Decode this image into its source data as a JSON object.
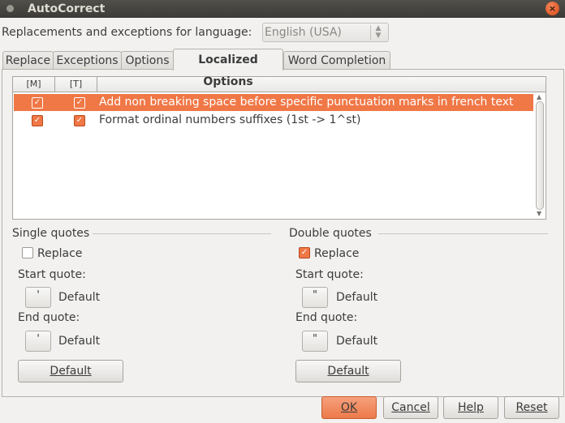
{
  "window": {
    "title": "AutoCorrect",
    "close_glyph": "×"
  },
  "language": {
    "label": "Replacements and exceptions for language:",
    "selected": "English (USA)"
  },
  "tabs": [
    {
      "label": "Replace",
      "active": false
    },
    {
      "label": "Exceptions",
      "active": false
    },
    {
      "label": "Options",
      "active": false
    },
    {
      "label": "Localized Options",
      "active": true
    },
    {
      "label": "Word Completion",
      "active": false
    }
  ],
  "options_list": {
    "columns": [
      "[M]",
      "[T]",
      ""
    ],
    "rows": [
      {
        "m": true,
        "t": true,
        "text": "Add non breaking space before specific punctuation marks in french text",
        "selected": true
      },
      {
        "m": true,
        "t": true,
        "text": "Format ordinal numbers suffixes (1st -> 1^st)",
        "selected": false
      }
    ]
  },
  "single_quotes": {
    "title": "Single quotes",
    "replace_label": "Replace",
    "replace_checked": false,
    "start_label": "Start quote:",
    "start_button": "'",
    "start_value": "Default",
    "end_label": "End quote:",
    "end_button": "'",
    "end_value": "Default",
    "default_button": "Default"
  },
  "double_quotes": {
    "title": "Double quotes",
    "replace_label": "Replace",
    "replace_checked": true,
    "start_label": "Start quote:",
    "start_button": "\"",
    "start_value": "Default",
    "end_label": "End quote:",
    "end_button": "\"",
    "end_value": "Default",
    "default_button": "Default"
  },
  "footer": {
    "ok": "OK",
    "cancel": "Cancel",
    "help": "Help",
    "reset": "Reset"
  },
  "icons": {
    "close": "close-icon",
    "check": "checkmark-icon",
    "spin": "spin-arrows-icon"
  },
  "colors": {
    "accent": "#f07746",
    "titlebar": "#3c3b37",
    "window_bg": "#f2f1f0"
  }
}
